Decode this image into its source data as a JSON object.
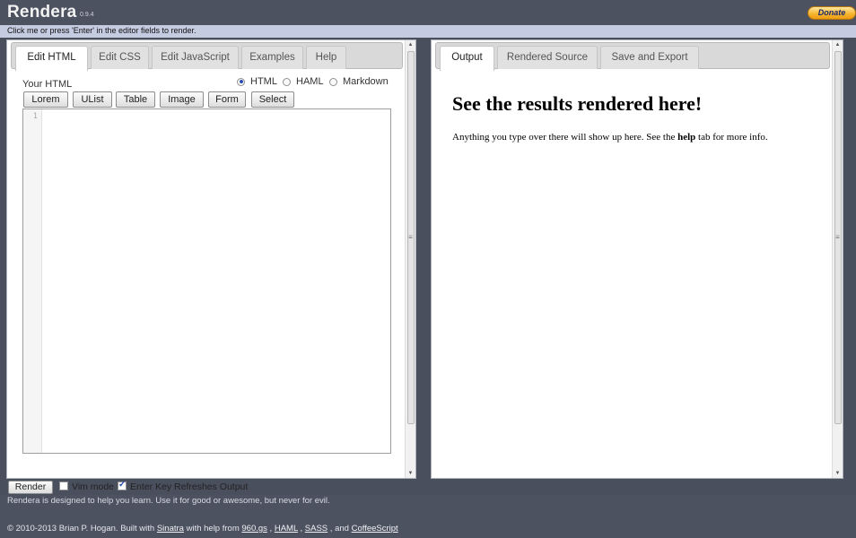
{
  "header": {
    "title": "Rendera",
    "version": "0.9.4",
    "donate_label": "Donate"
  },
  "hint": "Click me or press 'Enter' in the editor fields to render.",
  "left_tabs": [
    {
      "label": "Edit HTML",
      "active": true
    },
    {
      "label": "Edit CSS",
      "active": false
    },
    {
      "label": "Edit JavaScript",
      "active": false
    },
    {
      "label": "Examples",
      "active": false
    },
    {
      "label": "Help",
      "active": false
    }
  ],
  "editor": {
    "label": "Your HTML",
    "modes": [
      {
        "label": "HTML",
        "checked": true
      },
      {
        "label": "HAML",
        "checked": false
      },
      {
        "label": "Markdown",
        "checked": false
      }
    ],
    "insert_buttons": [
      "Lorem",
      "UList",
      "Table",
      "Image",
      "Form",
      "Select"
    ],
    "line_number": "1",
    "content": ""
  },
  "right_tabs": [
    {
      "label": "Output",
      "active": true
    },
    {
      "label": "Rendered Source",
      "active": false
    },
    {
      "label": "Save and Export",
      "active": false
    }
  ],
  "output": {
    "heading": "See the results rendered here!",
    "text_before": "Anything you type over there will show up here. See the ",
    "text_bold": "help",
    "text_after": " tab for more info."
  },
  "controls": {
    "render_label": "Render",
    "vim_label": "Vim mode",
    "vim_checked": false,
    "enter_label": "Enter Key Refreshes Output",
    "enter_checked": true
  },
  "footer": {
    "tagline": "Rendera is designed to help you learn. Use it for good or awesome, but never for evil.",
    "credits_prefix": "© 2010-2013 Brian P. Hogan. Built with ",
    "sinatra": "Sinatra",
    "with_help": " with help from ",
    "grid": "960.gs",
    "sep1": " , ",
    "haml": "HAML",
    "sep2": " , ",
    "sass": "SASS",
    "sep3": " , and ",
    "coffee": "CoffeeScript"
  },
  "colors": {
    "chrome": "#4d5261",
    "hint_bar": "#c5cbe0",
    "donate": "#f7b733"
  }
}
